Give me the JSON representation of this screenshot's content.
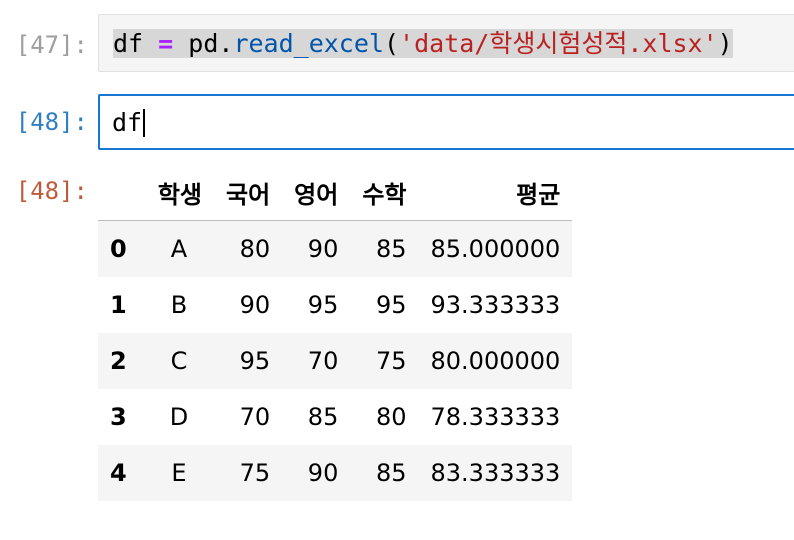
{
  "cells": {
    "prev_input": {
      "prompt": "[47]:",
      "code": {
        "var": "df",
        "op": "=",
        "obj": "pd.",
        "fn": "read_excel",
        "open": "(",
        "arg": "'data/학생시험성적.xlsx'",
        "close": ")"
      }
    },
    "active_input": {
      "prompt": "[48]:",
      "code": "df"
    },
    "output": {
      "prompt": "[48]:"
    }
  },
  "dataframe": {
    "columns": [
      "",
      "학생",
      "국어",
      "영어",
      "수학",
      "평균"
    ],
    "rows": [
      {
        "index": "0",
        "학생": "A",
        "국어": "80",
        "영어": "90",
        "수학": "85",
        "평균": "85.000000"
      },
      {
        "index": "1",
        "학생": "B",
        "국어": "90",
        "영어": "95",
        "수학": "95",
        "평균": "93.333333"
      },
      {
        "index": "2",
        "학생": "C",
        "국어": "95",
        "영어": "70",
        "수학": "75",
        "평균": "80.000000"
      },
      {
        "index": "3",
        "학생": "D",
        "국어": "70",
        "영어": "85",
        "수학": "80",
        "평균": "78.333333"
      },
      {
        "index": "4",
        "학생": "E",
        "국어": "75",
        "영어": "90",
        "수학": "85",
        "평균": "83.333333"
      }
    ]
  },
  "colors": {
    "prompt_prev": "#9e9e9e",
    "prompt_in": "#307fc1",
    "prompt_out": "#bf5b3d",
    "active_border": "#1976d2",
    "keyword_op": "#aa22ff",
    "function": "#0055aa",
    "string": "#ba2121"
  }
}
